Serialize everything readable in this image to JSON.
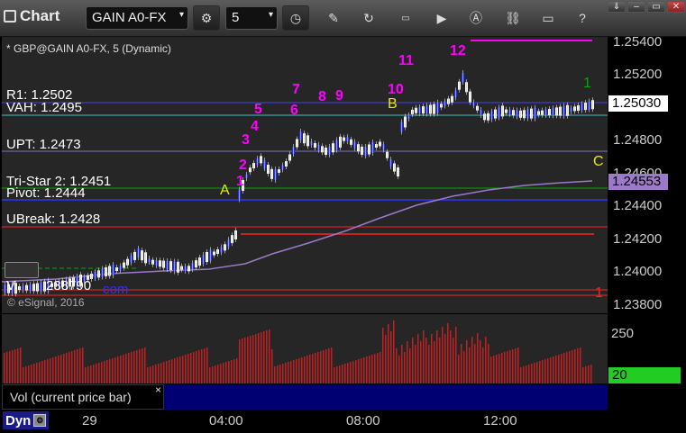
{
  "toolbar": {
    "app_title": "Chart",
    "symbol": "GAIN A0-FX",
    "interval": "5",
    "icons": [
      "settings-icon",
      "clock-icon",
      "pencil-icon",
      "refresh-icon",
      "get-icon",
      "play-icon",
      "alert-icon",
      "link-icon",
      "comment-icon",
      "help-icon"
    ]
  },
  "chart": {
    "header": "* GBP@GAIN A0-FX, 5 (Dynamic)",
    "copyright": "© eSignal, 2016",
    "levels": {
      "r1": "R1: 1.2502",
      "vah": "VAH: 1.2495",
      "upt": "UPT: 1.2473",
      "tristar": "Tri-Star 2: 1.2451",
      "pivot": "Pivot: 1.2444",
      "ubreak": "UBreak: 1.2428",
      "val_partial": "V",
      "val_value": "2387",
      "val_suffix": "90",
      "com": "com"
    },
    "markers": {
      "m1": "1",
      "m2": "2",
      "m3": "3",
      "m4": "4",
      "m5": "5",
      "m6": "6",
      "m7": "7",
      "m8": "8",
      "m9": "9",
      "m10": "10",
      "m11": "11",
      "m12": "12",
      "a": "A",
      "b": "B",
      "c": "C",
      "green_1": "1",
      "red_1": "1"
    },
    "price_axis": [
      "1.25400",
      "1.25200",
      "1.24800",
      "1.24600",
      "1.24400",
      "1.24200",
      "1.24000",
      "1.23800"
    ],
    "last_price": "1.25030",
    "ma_price": "1.24553"
  },
  "volume": {
    "axis": [
      "250"
    ],
    "current": "20",
    "label": "Vol (current price bar)",
    "close": "×"
  },
  "bottom": {
    "dyn": "Dyn",
    "times": [
      "29",
      "04:00",
      "08:00",
      "12:00"
    ]
  },
  "colors": {
    "magenta": "#ff00ff",
    "yellow": "#ffff00",
    "green": "#00c000",
    "red": "#ff2020",
    "purple_ma": "#9c79c9",
    "cyan_vah": "#40c0c0",
    "blue_line": "#3030ff"
  }
}
